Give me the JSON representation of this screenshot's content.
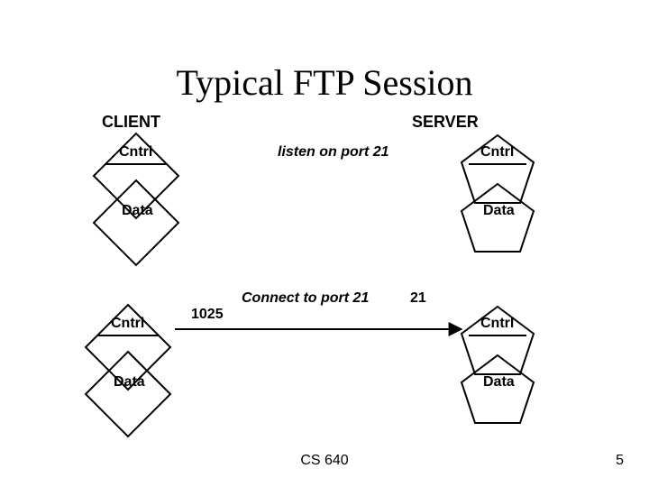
{
  "title": "Typical FTP Session",
  "headers": {
    "client": "CLIENT",
    "server": "SERVER"
  },
  "nodes": {
    "client_cntrl_1": "Cntrl",
    "client_data_1": "Data",
    "client_cntrl_2": "Cntrl",
    "client_data_2": "Data",
    "server_cntrl_1": "Cntrl",
    "server_data_1": "Data",
    "server_cntrl_2": "Cntrl",
    "server_data_2": "Data"
  },
  "messages": {
    "listen": "listen on port 21",
    "connect": "Connect to port 21"
  },
  "ports": {
    "client_port": "1025",
    "server_port": "21"
  },
  "footer": {
    "course": "CS 640",
    "slide_no": "5"
  }
}
